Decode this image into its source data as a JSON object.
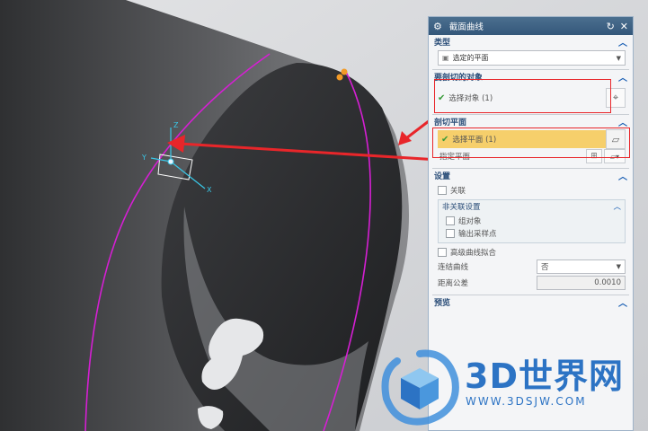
{
  "dialog": {
    "title": "截面曲线",
    "sections": {
      "type": {
        "label": "类型",
        "value": "选定的平面"
      },
      "objects": {
        "label": "要剖切的对象",
        "select_label": "选择对象 (1)"
      },
      "plane": {
        "label": "剖切平面",
        "select_label": "选择平面 (1)",
        "specify_label": "指定平面"
      },
      "settings": {
        "label": "设置",
        "associative": "关联",
        "nonassoc_group": "非关联设置",
        "group_objects": "组对象",
        "output_points": "输出采样点",
        "advanced_fit": "高级曲线拟合",
        "join_curves_label": "连结曲线",
        "join_curves_value": "否",
        "distance_tol_label": "距离公差",
        "distance_tol_value": "0.0010"
      },
      "preview": {
        "label": "预览"
      }
    }
  },
  "viewport": {
    "axis_x": "X",
    "axis_y": "Y",
    "axis_z": "Z"
  },
  "watermark": {
    "brand": "3D世界网",
    "url": "WWW.3DSJW.COM"
  },
  "colors": {
    "magenta_curve": "#d51fd3",
    "highlight_box": "#e8262a",
    "selection_yellow": "#f6cf6b",
    "brand_blue": "#2c73c4"
  }
}
